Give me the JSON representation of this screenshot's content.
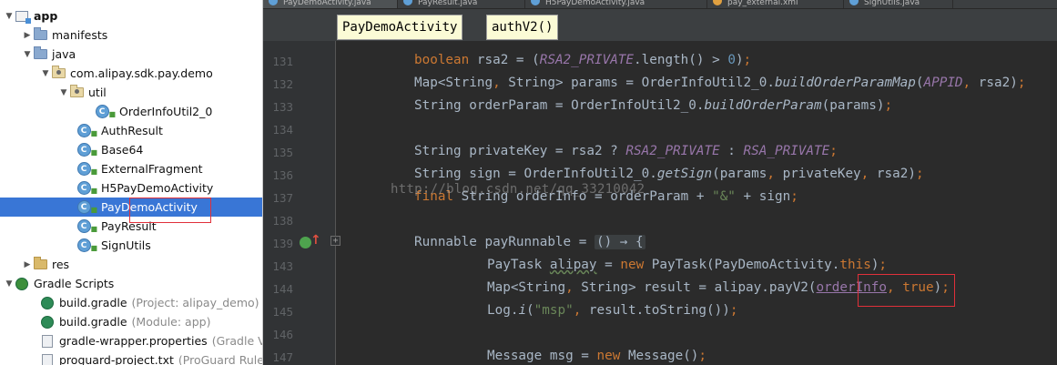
{
  "project_tree": {
    "items": [
      {
        "label": "app",
        "hint": ""
      },
      {
        "label": "manifests",
        "hint": ""
      },
      {
        "label": "java",
        "hint": ""
      },
      {
        "label": "com.alipay.sdk.pay.demo",
        "hint": ""
      },
      {
        "label": "util",
        "hint": ""
      },
      {
        "label": "OrderInfoUtil2_0",
        "hint": ""
      },
      {
        "label": "AuthResult",
        "hint": ""
      },
      {
        "label": "Base64",
        "hint": ""
      },
      {
        "label": "ExternalFragment",
        "hint": ""
      },
      {
        "label": "H5PayDemoActivity",
        "hint": ""
      },
      {
        "label": "PayDemoActivity",
        "hint": ""
      },
      {
        "label": "PayResult",
        "hint": ""
      },
      {
        "label": "SignUtils",
        "hint": ""
      },
      {
        "label": "res",
        "hint": ""
      },
      {
        "label": "Gradle Scripts",
        "hint": ""
      },
      {
        "label": "build.gradle",
        "hint": "(Project: alipay_demo)"
      },
      {
        "label": "build.gradle",
        "hint": "(Module: app)"
      },
      {
        "label": "gradle-wrapper.properties",
        "hint": "(Gradle Ve"
      },
      {
        "label": "proguard-project.txt",
        "hint": "(ProGuard Rules"
      }
    ],
    "selected": "PayDemoActivity",
    "class_icon_letter": "C"
  },
  "editor": {
    "tabs": [
      "PayDemoActivity.java",
      "PayResult.java",
      "H5PayDemoActivity.java",
      "pay_external.xml",
      "SignUtils.java"
    ],
    "breadcrumb": [
      "PayDemoActivity",
      "authV2()"
    ],
    "fold_symbol": "+",
    "line_numbers": [
      "131",
      "132",
      "133",
      "134",
      "135",
      "136",
      "137",
      "138",
      "139",
      "143",
      "144",
      "145",
      "146",
      "147"
    ],
    "watermark": "http://blog.csdn.net/qq_33210042"
  },
  "colors": {
    "selection": "#3976d6",
    "editor_bg": "#2b2b2b",
    "highlight_box": "#e0303a"
  }
}
